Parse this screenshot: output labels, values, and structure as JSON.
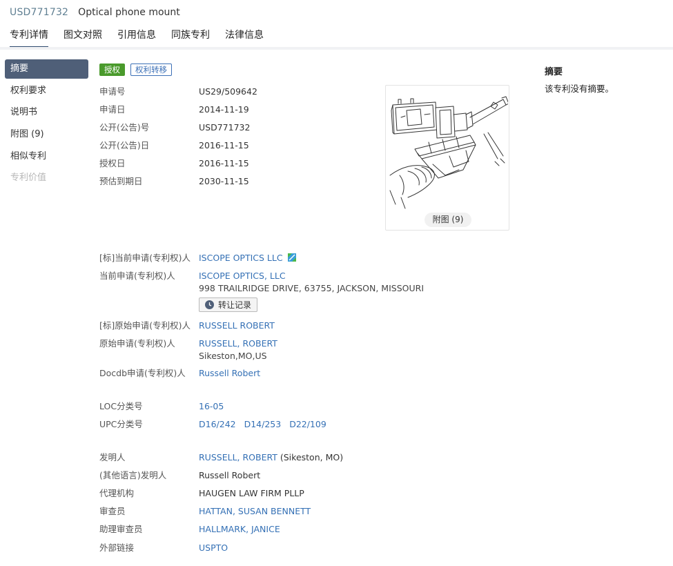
{
  "header": {
    "patent_number": "USD771732",
    "patent_title": "Optical phone mount"
  },
  "tabs": [
    "专利详情",
    "图文对照",
    "引用信息",
    "同族专利",
    "法律信息"
  ],
  "sidebar": {
    "items": [
      {
        "label": "摘要"
      },
      {
        "label": "权利要求"
      },
      {
        "label": "说明书"
      },
      {
        "label": "附图 (9)"
      },
      {
        "label": "相似专利"
      },
      {
        "label": "专利价值"
      }
    ]
  },
  "badges": {
    "status": "授权",
    "event": "权利转移"
  },
  "dates": [
    {
      "label": "申请号",
      "value": "US29/509642"
    },
    {
      "label": "申请日",
      "value": "2014-11-19"
    },
    {
      "label": "公开(公告)号",
      "value": "USD771732"
    },
    {
      "label": "公开(公告)日",
      "value": "2016-11-15"
    },
    {
      "label": "授权日",
      "value": "2016-11-15"
    },
    {
      "label": "预估到期日",
      "value": "2030-11-15"
    }
  ],
  "figure": {
    "button_label": "附图 (9)"
  },
  "parties": {
    "std_current_assignee_label": "[标]当前申请(专利权)人",
    "std_current_assignee": "ISCOPE OPTICS LLC",
    "current_assignee_label": "当前申请(专利权)人",
    "current_assignee": "ISCOPE OPTICS, LLC",
    "current_assignee_address": "998 TRAILRIDGE DRIVE, 63755, JACKSON, MISSOURI",
    "transfer_button": "转让记录",
    "std_original_assignee_label": "[标]原始申请(专利权)人",
    "std_original_assignee": "RUSSELL ROBERT",
    "original_assignee_label": "原始申请(专利权)人",
    "original_assignee": "RUSSELL, ROBERT",
    "original_assignee_location": "Sikeston,MO,US",
    "docdb_label": "Docdb申请(专利权)人",
    "docdb_assignee": "Russell Robert"
  },
  "classification": {
    "loc_label": "LOC分类号",
    "loc": "16-05",
    "upc_label": "UPC分类号",
    "upc": [
      "D16/242",
      "D14/253",
      "D22/109"
    ]
  },
  "people": {
    "inventor_label": "发明人",
    "inventor": "RUSSELL, ROBERT",
    "inventor_location": "(Sikeston, MO)",
    "other_lang_inventor_label": "(其他语言)发明人",
    "other_lang_inventor": "Russell Robert",
    "agency_label": "代理机构",
    "agency": "HAUGEN LAW FIRM PLLP",
    "examiner_label": "审查员",
    "examiner": "HATTAN, SUSAN BENNETT",
    "assistant_examiner_label": "助理审查员",
    "assistant_examiner": "HALLMARK, JANICE",
    "external_link_label": "外部链接",
    "external_link": "USPTO"
  },
  "abstract": {
    "title": "摘要",
    "text": "该专利没有摘要。"
  },
  "colors": {
    "accent": "#2e4a6e",
    "link": "#3470b5",
    "granted": "#4a9a2c",
    "sidebar_active": "#4f5f78"
  }
}
